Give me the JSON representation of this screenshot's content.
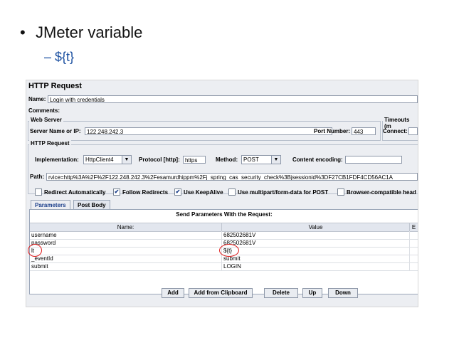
{
  "slide": {
    "bullet1": "JMeter variable",
    "bullet1_mark": "•",
    "bullet2": "– ${t}"
  },
  "panel": {
    "title": "HTTP Request",
    "name_label": "Name:",
    "name_value": "Login with credentials",
    "comments_label": "Comments:",
    "web_server_label": "Web Server",
    "server_label": "Server Name or IP:",
    "server_value": "122.248.242.3",
    "port_label": "Port Number:",
    "port_value": "443",
    "timeouts_label": "Timeouts (m",
    "connect_label": "Connect:",
    "http_request_group": "HTTP Request",
    "implementation_label": "Implementation:",
    "implementation_value": "HttpClient4",
    "protocol_label": "Protocol [http]:",
    "protocol_value": "https",
    "method_label": "Method:",
    "method_value": "POST",
    "encoding_label": "Content encoding:",
    "path_label": "Path:",
    "path_value": "rvice=http%3A%2F%2F122.248.242.3%2Fesamurdhippm%2Fj_spring_cas_security_check%3Bjsessionid%3DF27CB1FDF4CD56AC1A",
    "checkboxes": [
      {
        "label": "Redirect Automatically",
        "checked": false
      },
      {
        "label": "Follow Redirects",
        "checked": true
      },
      {
        "label": "Use KeepAlive",
        "checked": true
      },
      {
        "label": "Use multipart/form-data for POST",
        "checked": false
      },
      {
        "label": "Browser-compatible head",
        "checked": false
      }
    ],
    "check_mark": "✔",
    "dropdown_arrow": "▼",
    "tabs": [
      "Parameters",
      "Post Body"
    ],
    "table_title": "Send Parameters With the Request:",
    "table_headers": [
      "Name:",
      "Value",
      "E"
    ],
    "rows": [
      {
        "name": "username",
        "value": "682502681V"
      },
      {
        "name": "password",
        "value": "682502681V"
      },
      {
        "name": "lt",
        "value": "${t}"
      },
      {
        "name": "_eventId",
        "value": "submit"
      },
      {
        "name": "submit",
        "value": "LOGIN"
      }
    ],
    "buttons": [
      "Add",
      "Add from Clipboard",
      "Delete",
      "Up",
      "Down"
    ]
  },
  "colors": {
    "highlight": "#e02020",
    "bullet2": "#1a4fa0"
  }
}
